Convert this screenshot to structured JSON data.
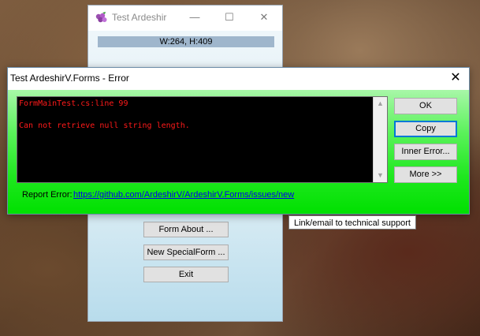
{
  "main_window": {
    "title": "Test Ardeshir",
    "controls": {
      "minimize": "—",
      "maximize": "☐",
      "close": "✕"
    },
    "size_label": "W:264, H:409",
    "buttons": {
      "form_about": "Form About ...",
      "new_special_form": "New SpecialForm ...",
      "exit": "Exit"
    }
  },
  "error_dialog": {
    "title": "Test ArdeshirV.Forms - Error",
    "close": "✕",
    "console_lines": [
      "FormMainTest.cs:line 99",
      "",
      "Can not retrieve null string length."
    ],
    "scroll_up": "▲",
    "scroll_down": "▼",
    "buttons": {
      "ok": "OK",
      "copy": "Copy",
      "inner_error": "Inner Error...",
      "more": "More >>"
    },
    "report_label": "Report Error:",
    "report_link": "https://github.com/ArdeshirV/ArdeshirV.Forms/issues/new"
  },
  "tooltip": "Link/email to technical support",
  "colors": {
    "console_text": "#ff1a1a",
    "dialog_gradient_end": "#00e000",
    "focus_border": "#0078d7"
  }
}
